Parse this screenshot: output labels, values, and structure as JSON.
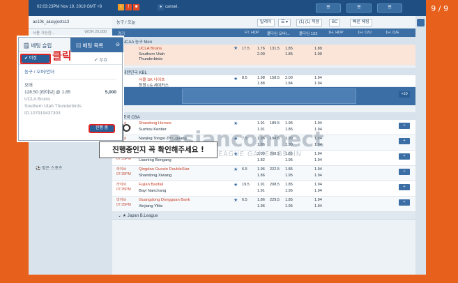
{
  "pager": "9 / 9",
  "topbar": {
    "clock": "02:03:23PM Nov 19, 2019 GMT +8",
    "user": "cansel.",
    "btn1": "",
    "btn2": ""
  },
  "account": {
    "id": "ac10k_alucyjosts13",
    "line2": "사용 가능한...",
    "won": "WON 20,000"
  },
  "popup": {
    "tab_slip": "베팅 슬립",
    "tab_list": "베팅 목록",
    "sub_active": "비정",
    "sub_other": "무효",
    "category": "농구 / 오버/언더",
    "selection": "오버",
    "odds_line": "128.50 [라이브] @ 1.85",
    "amount": "5,000",
    "team1": "UCLA Bruins",
    "team2": "Southern Utah Thunderbirds",
    "bet_id": "ID:107919437303",
    "status": "진행 중"
  },
  "annotations": {
    "click": "클릭",
    "callout": "진행중인지 꼭 확인해주세요 !"
  },
  "sidebar": {
    "sports": "맞은 스포츠"
  },
  "toolbar": {
    "b1": "탈레이",
    "b2": "(1) (1) 적용",
    "b3": "BC",
    "b4": "빠른 베팅"
  },
  "columns": {
    "c0": "경기",
    "c1": "FT. HDP",
    "c2": "풀타임 오버/...",
    "c3": "풀타임 1X2",
    "c4": "1H. HDP",
    "c5": "1H. O/U",
    "c6": "1H. O/E"
  },
  "top_header": "농구 / 오늘",
  "league1": "NCAA 농구 Men",
  "league2": "대한민국 KBL",
  "league3": "중국 CBA",
  "league4": "Japan B.League",
  "watermark": {
    "big": "asianconnect",
    "small": "LEAGUE GAMES BEGIN"
  },
  "rows": [
    {
      "time": "",
      "t1": "UCLA Bruins",
      "t2": "Southern Utah Thunderbirds",
      "red1": true,
      "hl": true,
      "a": "17.5",
      "b": "1.76",
      "c": "131.5",
      "d": "1.85",
      "e": "1.89",
      "f": "2.00",
      "g": "1.85",
      "h": "1.99"
    },
    {
      "time": "",
      "t1": "서울 SK 나이츠",
      "t2": "창원 LG 세이커스",
      "red1": true,
      "hl": false,
      "a": "8.5",
      "b": "1.98",
      "c": "158.5",
      "d": "2.00",
      "e": "1.94",
      "f": "1.88",
      "g": "1.84",
      "h": "1.94"
    },
    {
      "time": "라이브\n07:35PM",
      "t1": "Shandong Heroes",
      "t2": "Suzhou Kentier",
      "red1": true,
      "hl": false,
      "a": "",
      "b": "1.91",
      "c": "189.5",
      "d": "1.95",
      "e": "1.94",
      "f": "1.91",
      "g": "1.85",
      "h": "1.94"
    },
    {
      "time": "라이브\n07:35PM",
      "t1": "Nanjing Tongxi Zhouguang",
      "t2": "Zhejiang Guangsha",
      "red1": false,
      "hl": false,
      "a": "7.5",
      "b": "1.96",
      "c": "194.5",
      "d": "1.90",
      "e": "1.94",
      "f": "1.86",
      "g": "1.90",
      "h": "1.94"
    },
    {
      "time": "라이브\n07:35PM",
      "t1": "Zhejiang Chouzhou Bank",
      "t2": "Liaoning Bengang",
      "red1": false,
      "hl": false,
      "a": "",
      "b": "2.00",
      "c": "208.5",
      "d": "1.85",
      "e": "1.94",
      "f": "1.82",
      "g": "1.95",
      "h": "1.94"
    },
    {
      "time": "라이브\n07:35PM",
      "t1": "Qingdao Guoxin DoubleStar",
      "t2": "Shandong Xiwang",
      "red1": true,
      "hl": false,
      "a": "6.5",
      "b": "1.96",
      "c": "222.5",
      "d": "1.85",
      "e": "1.94",
      "f": "1.86",
      "g": "1.95",
      "h": "1.94"
    },
    {
      "time": "라이브\n07:35PM",
      "t1": "Fujian Baofali",
      "t2": "Bayi Nanchang",
      "red1": true,
      "hl": false,
      "a": "19.5",
      "b": "1.91",
      "c": "208.5",
      "d": "1.85",
      "e": "1.94",
      "f": "1.91",
      "g": "1.95",
      "h": "1.94"
    },
    {
      "time": "라이브\n07:35PM",
      "t1": "Guangdong Dongguan Bank",
      "t2": "Xinjiang Yilite",
      "red1": true,
      "hl": false,
      "a": "6.5",
      "b": "1.86",
      "c": "229.5",
      "d": "1.85",
      "e": "1.94",
      "f": "1.96",
      "g": "1.95",
      "h": "1.94"
    }
  ]
}
